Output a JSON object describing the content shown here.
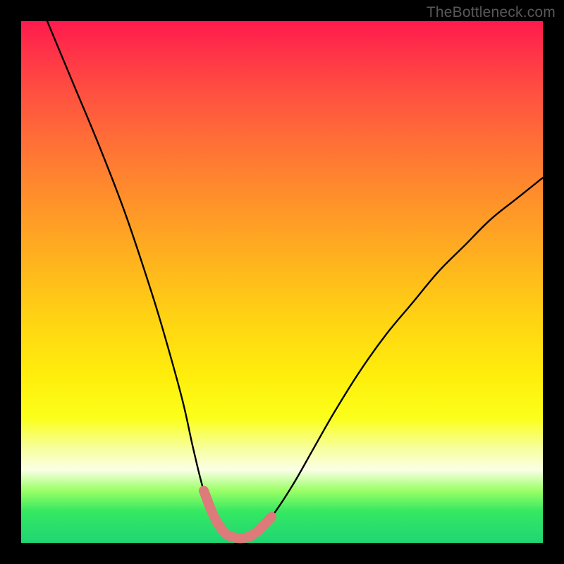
{
  "watermark": "TheBottleneck.com",
  "chart_data": {
    "type": "line",
    "title": "",
    "xlabel": "",
    "ylabel": "",
    "xlim": [
      0,
      100
    ],
    "ylim": [
      0,
      100
    ],
    "series": [
      {
        "name": "bottleneck-curve",
        "x": [
          5,
          10,
          15,
          20,
          25,
          28,
          31,
          33,
          35,
          37,
          39,
          41,
          43,
          45,
          48,
          52,
          56,
          60,
          65,
          70,
          75,
          80,
          85,
          90,
          95,
          100
        ],
        "y": [
          100,
          88,
          76,
          63,
          48,
          38,
          27,
          18,
          10,
          5,
          2,
          1,
          1,
          2,
          5,
          11,
          18,
          25,
          33,
          40,
          46,
          52,
          57,
          62,
          66,
          70
        ]
      }
    ],
    "highlight_region": {
      "name": "optimal-range",
      "x": [
        35,
        37,
        39,
        41,
        43,
        45,
        48
      ],
      "y": [
        10,
        5,
        2,
        1,
        1,
        2,
        5
      ]
    },
    "background_gradient": {
      "top_color": "#ff1a4d",
      "mid_color": "#ffee0c",
      "bottom_color": "#1fd673"
    }
  }
}
